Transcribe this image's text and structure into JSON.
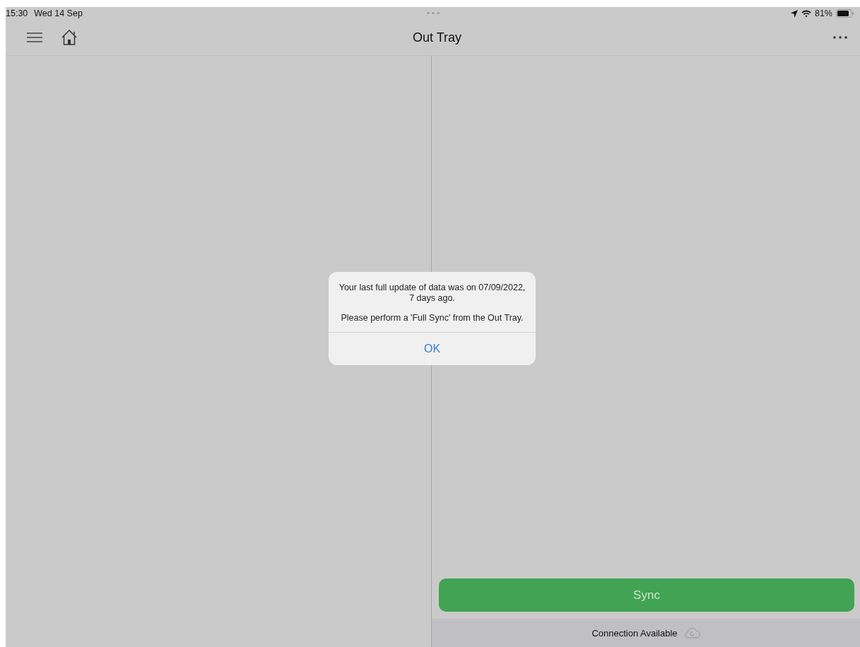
{
  "status_bar": {
    "time": "15:30",
    "date": "Wed 14 Sep",
    "battery": "81%"
  },
  "nav_bar": {
    "title": "Out Tray"
  },
  "sync_button": {
    "label": "Sync"
  },
  "connection": {
    "label": "Connection Available"
  },
  "alert": {
    "lines": [
      "Your last full update of data was on 07/09/2022, 7 days ago.",
      "Please perform a 'Full Sync' from the Out Tray."
    ],
    "button": "OK"
  }
}
